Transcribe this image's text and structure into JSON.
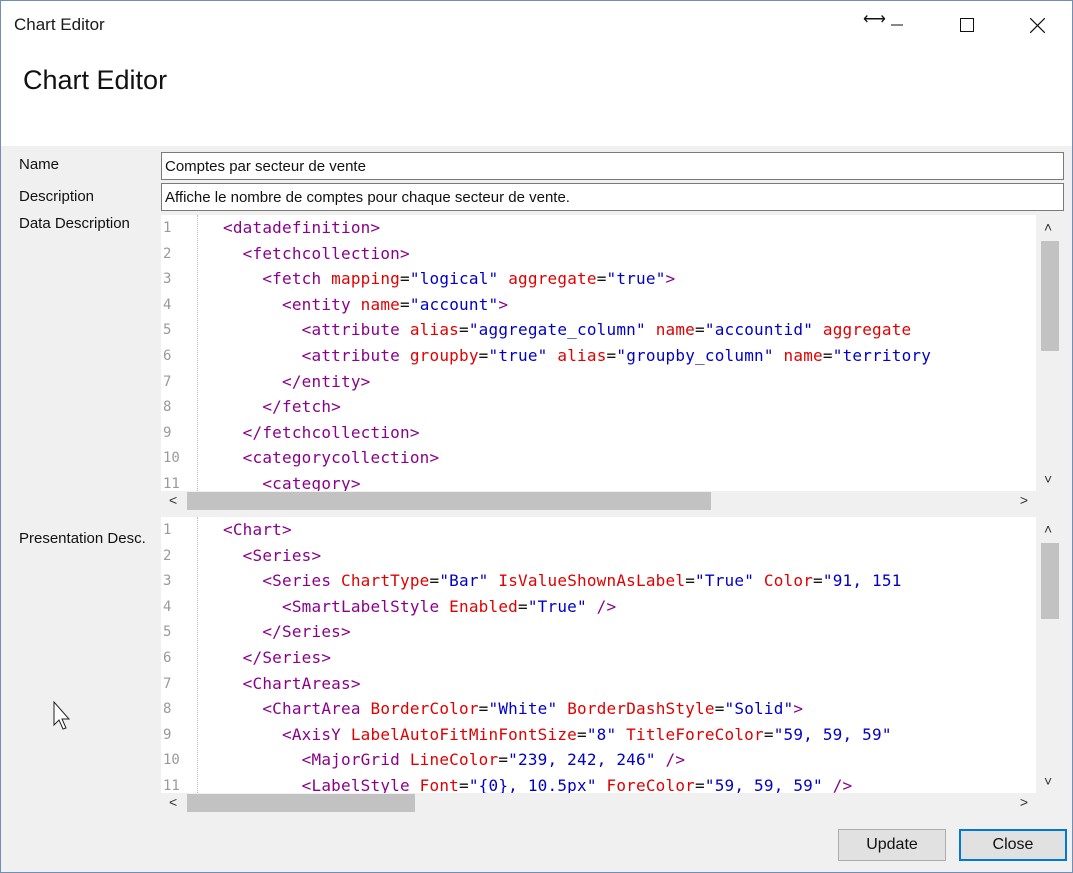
{
  "window": {
    "title": "Chart Editor",
    "resize_icon": "⟷",
    "controls": {
      "minimize": "minimize-icon",
      "maximize": "maximize-icon",
      "close": "close-icon"
    }
  },
  "header": {
    "title": "Chart Editor"
  },
  "form": {
    "name_label": "Name",
    "name_value": "Comptes par secteur de vente",
    "description_label": "Description",
    "description_value": "Affiche le nombre de comptes pour chaque secteur de vente.",
    "data_description_label": "Data Description",
    "presentation_label": "Presentation Desc."
  },
  "data_editor": {
    "line_numbers": [
      "1",
      "2",
      "3",
      "4",
      "5",
      "6",
      "7",
      "8",
      "9",
      "10",
      "11"
    ],
    "lines": [
      [
        [
          "tag",
          "<datadefinition>"
        ]
      ],
      [
        [
          "tag",
          "  <fetchcollection>"
        ]
      ],
      [
        [
          "tag",
          "    <fetch "
        ],
        [
          "an",
          "mapping"
        ],
        [
          "pl",
          "="
        ],
        [
          "av",
          "\"logical\""
        ],
        [
          "pl",
          " "
        ],
        [
          "an",
          "aggregate"
        ],
        [
          "pl",
          "="
        ],
        [
          "av",
          "\"true\""
        ],
        [
          "tag",
          ">"
        ]
      ],
      [
        [
          "tag",
          "      <entity "
        ],
        [
          "an",
          "name"
        ],
        [
          "pl",
          "="
        ],
        [
          "av",
          "\"account\""
        ],
        [
          "tag",
          ">"
        ]
      ],
      [
        [
          "tag",
          "        <attribute "
        ],
        [
          "an",
          "alias"
        ],
        [
          "pl",
          "="
        ],
        [
          "av",
          "\"aggregate_column\""
        ],
        [
          "pl",
          " "
        ],
        [
          "an",
          "name"
        ],
        [
          "pl",
          "="
        ],
        [
          "av",
          "\"accountid\""
        ],
        [
          "pl",
          " "
        ],
        [
          "an",
          "aggregate"
        ]
      ],
      [
        [
          "tag",
          "        <attribute "
        ],
        [
          "an",
          "groupby"
        ],
        [
          "pl",
          "="
        ],
        [
          "av",
          "\"true\""
        ],
        [
          "pl",
          " "
        ],
        [
          "an",
          "alias"
        ],
        [
          "pl",
          "="
        ],
        [
          "av",
          "\"groupby_column\""
        ],
        [
          "pl",
          " "
        ],
        [
          "an",
          "name"
        ],
        [
          "pl",
          "="
        ],
        [
          "av",
          "\"territory"
        ]
      ],
      [
        [
          "tag",
          "      </entity>"
        ]
      ],
      [
        [
          "tag",
          "    </fetch>"
        ]
      ],
      [
        [
          "tag",
          "  </fetchcollection>"
        ]
      ],
      [
        [
          "tag",
          "  <categorycollection>"
        ]
      ],
      [
        [
          "tag",
          "    <category>"
        ]
      ]
    ]
  },
  "presentation_editor": {
    "line_numbers": [
      "1",
      "2",
      "3",
      "4",
      "5",
      "6",
      "7",
      "8",
      "9",
      "10",
      "11"
    ],
    "lines": [
      [
        [
          "tag",
          "<Chart>"
        ]
      ],
      [
        [
          "tag",
          "  <Series>"
        ]
      ],
      [
        [
          "tag",
          "    <Series "
        ],
        [
          "an",
          "ChartType"
        ],
        [
          "pl",
          "="
        ],
        [
          "av",
          "\"Bar\""
        ],
        [
          "pl",
          " "
        ],
        [
          "an",
          "IsValueShownAsLabel"
        ],
        [
          "pl",
          "="
        ],
        [
          "av",
          "\"True\""
        ],
        [
          "pl",
          " "
        ],
        [
          "an",
          "Color"
        ],
        [
          "pl",
          "="
        ],
        [
          "av",
          "\"91, 151"
        ]
      ],
      [
        [
          "tag",
          "      <SmartLabelStyle "
        ],
        [
          "an",
          "Enabled"
        ],
        [
          "pl",
          "="
        ],
        [
          "av",
          "\"True\""
        ],
        [
          "tag",
          " />"
        ]
      ],
      [
        [
          "tag",
          "    </Series>"
        ]
      ],
      [
        [
          "tag",
          "  </Series>"
        ]
      ],
      [
        [
          "tag",
          "  <ChartAreas>"
        ]
      ],
      [
        [
          "tag",
          "    <ChartArea "
        ],
        [
          "an",
          "BorderColor"
        ],
        [
          "pl",
          "="
        ],
        [
          "av",
          "\"White\""
        ],
        [
          "pl",
          " "
        ],
        [
          "an",
          "BorderDashStyle"
        ],
        [
          "pl",
          "="
        ],
        [
          "av",
          "\"Solid\""
        ],
        [
          "tag",
          ">"
        ]
      ],
      [
        [
          "tag",
          "      <AxisY "
        ],
        [
          "an",
          "LabelAutoFitMinFontSize"
        ],
        [
          "pl",
          "="
        ],
        [
          "av",
          "\"8\""
        ],
        [
          "pl",
          " "
        ],
        [
          "an",
          "TitleForeColor"
        ],
        [
          "pl",
          "="
        ],
        [
          "av",
          "\"59, 59, 59\""
        ]
      ],
      [
        [
          "tag",
          "        <MajorGrid "
        ],
        [
          "an",
          "LineColor"
        ],
        [
          "pl",
          "="
        ],
        [
          "av",
          "\"239, 242, 246\""
        ],
        [
          "tag",
          " />"
        ]
      ],
      [
        [
          "tag",
          "        <LabelStyle "
        ],
        [
          "an",
          "Font"
        ],
        [
          "pl",
          "="
        ],
        [
          "av",
          "\"{0}, 10.5px\""
        ],
        [
          "pl",
          " "
        ],
        [
          "an",
          "ForeColor"
        ],
        [
          "pl",
          "="
        ],
        [
          "av",
          "\"59, 59, 59\""
        ],
        [
          "tag",
          " />"
        ]
      ]
    ]
  },
  "scroll_glyphs": {
    "up": "˄",
    "down": "˅",
    "left": "<",
    "right": ">"
  },
  "buttons": {
    "update": "Update",
    "close": "Close"
  },
  "colors": {
    "tag": "#8b008b",
    "attribute_name": "#e00000",
    "attribute_value": "#0000c8",
    "accent": "#0078d7"
  }
}
